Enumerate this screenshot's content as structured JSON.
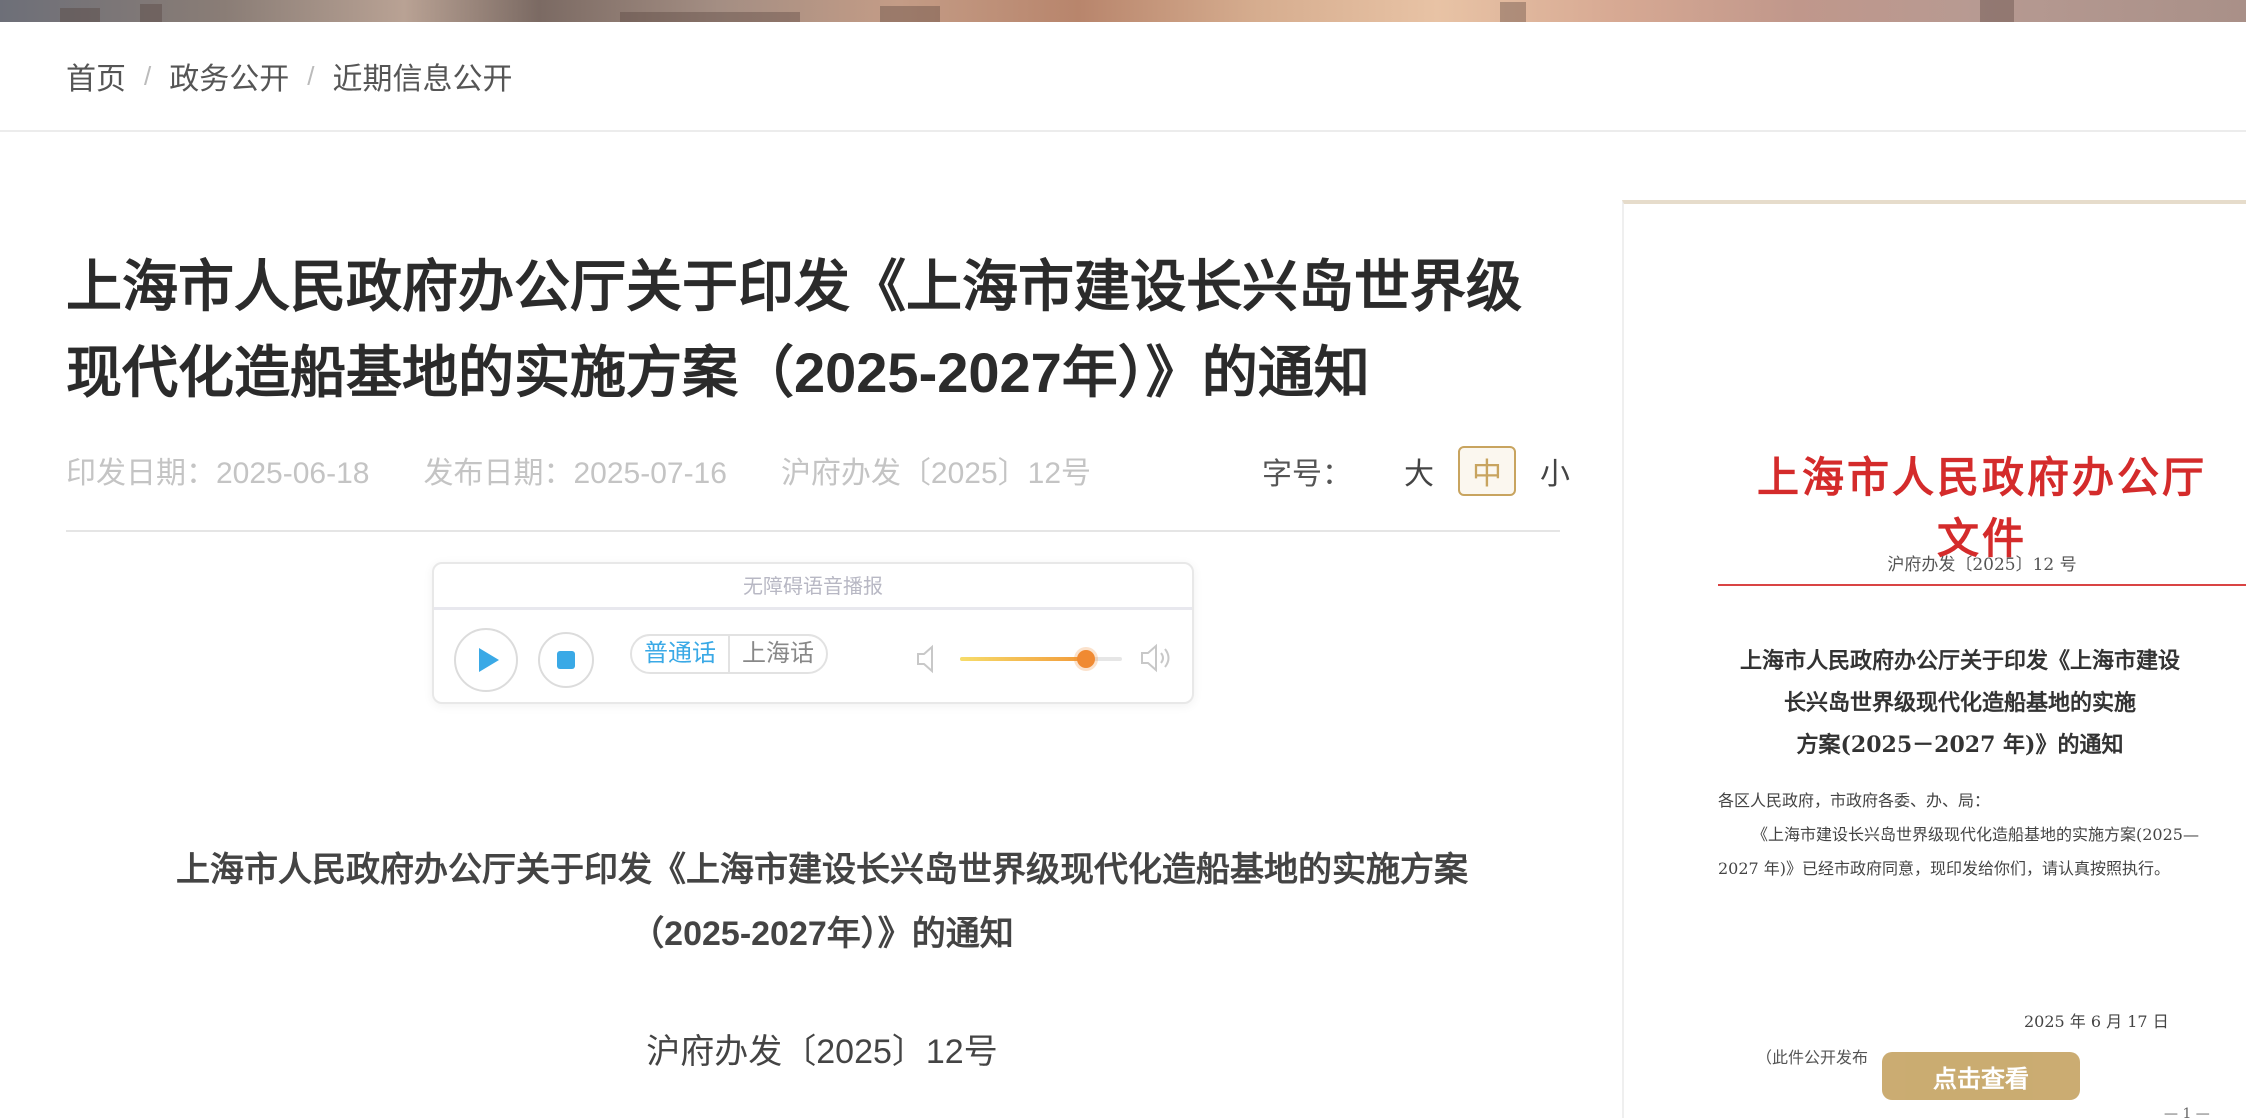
{
  "breadcrumb": {
    "items": [
      "首页",
      "政务公开",
      "近期信息公开"
    ],
    "separator": "/"
  },
  "article": {
    "title": "上海市人民政府办公厅关于印发《上海市建设长兴岛世界级现代化造船基地的实施方案（2025-2027年）》的通知",
    "print_date": "印发日期：2025-06-18",
    "publish_date": "发布日期：2025-07-16",
    "doc_number": "沪府办发〔2025〕12号"
  },
  "font_size": {
    "label": "字号：",
    "options": [
      "大",
      "中",
      "小"
    ],
    "selected": "中",
    "active_color": "#c8a45f"
  },
  "audio_player": {
    "title": "无障碍语音播报",
    "play_icon": "play-icon",
    "stop_icon": "stop-icon",
    "languages": [
      "普通话",
      "上海话"
    ],
    "selected_language": "普通话",
    "volume_level": 0.78,
    "accent_color": "#3aa9e6"
  },
  "content": {
    "title_line1": "上海市人民政府办公厅关于印发《上海市建设长兴岛世界级现代化造船基地的实施方案",
    "title_line2": "（2025-2027年）》的通知",
    "doc_number": "沪府办发〔2025〕12号"
  },
  "document_preview": {
    "header": "上海市人民政府办公厅文件",
    "header_color": "#d42b2b",
    "doc_number": "沪府办发〔2025〕12 号",
    "title_line1": "上海市人民政府办公厅关于印发《上海市建设",
    "title_line2": "长兴岛世界级现代化造船基地的实施",
    "title_line3": "方案(2025－2027 年)》的通知",
    "recipients": "各区人民政府，市政府各委、办、局：",
    "body_line1": "《上海市建设长兴岛世界级现代化造船基地的实施方案(2025—",
    "body_line2": "2027 年)》已经市政府同意，现印发给你们，请认真按照执行。",
    "date": "2025 年 6 月 17 日",
    "note": "（此件公开发布",
    "view_button": "点击查看",
    "page_number": "— 1 —"
  }
}
